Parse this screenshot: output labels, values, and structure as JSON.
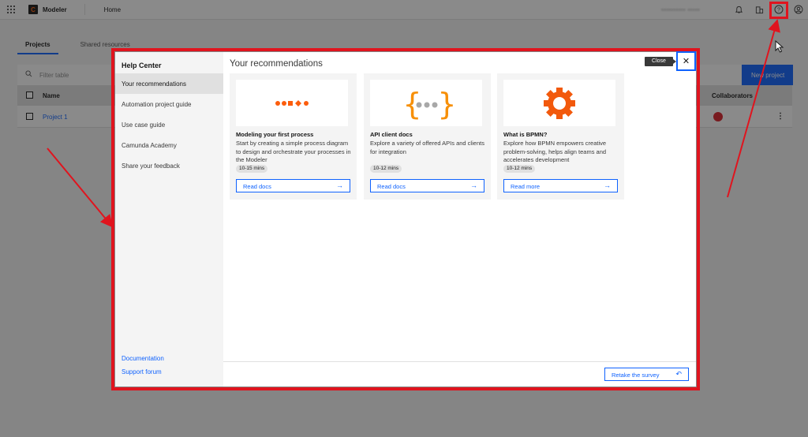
{
  "topbar": {
    "app_name": "Modeler",
    "home_link": "Home",
    "user_name": "•••••••••• •••••"
  },
  "page": {
    "tabs": [
      "Projects",
      "Shared resources"
    ],
    "filter_placeholder": "Filter table",
    "new_project_label": "New project",
    "columns": {
      "name": "Name",
      "collaborators": "Collaborators"
    },
    "rows": [
      {
        "name": "Project 1"
      }
    ]
  },
  "help_center": {
    "title": "Help Center",
    "items": [
      "Your recommendations",
      "Automation project guide",
      "Use case guide",
      "Camunda Academy",
      "Share your feedback"
    ],
    "footer_links": [
      "Documentation",
      "Support forum"
    ],
    "content_title": "Your recommendations",
    "close_tooltip": "Close",
    "retake_label": "Retake the survey",
    "cards": [
      {
        "title": "Modeling your first process",
        "desc": "Start by creating a simple process diagram to design and orchestrate your processes in the Modeler",
        "duration": "10-15 mins",
        "action": "Read docs"
      },
      {
        "title": "API client docs",
        "desc": "Explore a variety of offered APIs and clients for integration",
        "duration": "10-12 mins",
        "action": "Read docs"
      },
      {
        "title": "What is BPMN?",
        "desc": "Explore how BPMN empowers creative problem-solving, helps align teams and accelerates development",
        "duration": "10-12 mins",
        "action": "Read more"
      }
    ]
  },
  "colors": {
    "accent": "#0f62fe",
    "brand_orange": "#fc5d0d",
    "annotation_red": "#e0141e"
  }
}
